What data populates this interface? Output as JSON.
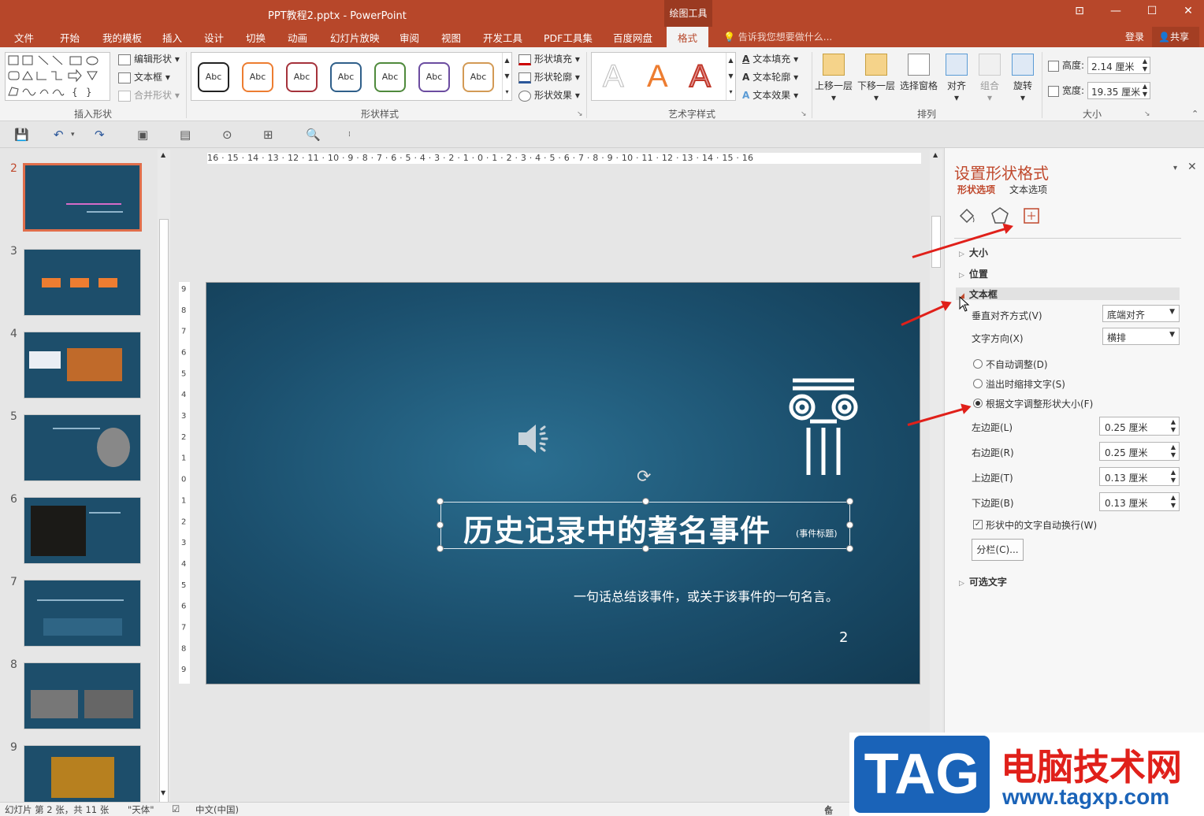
{
  "window": {
    "title": "PPT教程2.pptx - PowerPoint",
    "context_tab_group": "绘图工具",
    "controls": [
      "⊡",
      "—",
      "☐",
      "✕"
    ]
  },
  "menu": {
    "tabs": [
      "文件",
      "开始",
      "我的模板",
      "插入",
      "设计",
      "切换",
      "动画",
      "幻灯片放映",
      "审阅",
      "视图",
      "开发工具",
      "PDF工具集",
      "百度网盘",
      "格式"
    ],
    "active_tab": "格式",
    "tell_me": "告诉我您想要做什么...",
    "login": "登录",
    "share": "共享"
  },
  "ribbon": {
    "insert_shapes": {
      "label": "插入形状",
      "edit_shape": "编辑形状",
      "text_box": "文本框",
      "merge_shapes": "合并形状"
    },
    "shape_styles": {
      "label": "形状样式",
      "swatch_text": "Abc",
      "swatch_colors": [
        "#222222",
        "#ed7d31",
        "#a5323b",
        "#2f5f8a",
        "#4f8a3c",
        "#6b4ca0",
        "#d39a55"
      ],
      "fill": "形状填充",
      "outline": "形状轮廓",
      "effects": "形状效果"
    },
    "wordart_styles": {
      "label": "艺术字样式",
      "sample": "A",
      "text_fill": "文本填充",
      "text_outline": "文本轮廓",
      "text_effects": "文本效果"
    },
    "arrange": {
      "label": "排列",
      "bring_forward": "上移一层",
      "send_backward": "下移一层",
      "selection_pane": "选择窗格",
      "align": "对齐",
      "group": "组合",
      "rotate": "旋转"
    },
    "size": {
      "label": "大小",
      "height_label": "高度:",
      "height_value": "2.14 厘米",
      "width_label": "宽度:",
      "width_value": "19.35 厘米"
    }
  },
  "ruler": {
    "horizontal": "16 · 15 · 14 · 13 · 12 · 11 · 10 · 9 · 8 · 7 · 6 · 5 · 4 · 3 · 2 · 1 · 0 · 1 · 2 · 3 · 4 · 5 · 6 · 7 · 8 · 9 · 10 · 11 · 12 · 13 · 14 · 15 · 16",
    "vertical": [
      "9",
      "8",
      "7",
      "6",
      "5",
      "4",
      "3",
      "2",
      "1",
      "0",
      "1",
      "2",
      "3",
      "4",
      "5",
      "6",
      "7",
      "8",
      "9"
    ]
  },
  "thumbnails": [
    {
      "num": "2"
    },
    {
      "num": "3"
    },
    {
      "num": "4"
    },
    {
      "num": "5"
    },
    {
      "num": "6"
    },
    {
      "num": "7"
    },
    {
      "num": "8"
    },
    {
      "num": "9"
    }
  ],
  "slide": {
    "title": "历史记录中的著名事件",
    "title_tag": "(事件标题)",
    "tagline": "一句话总结该事件，或关于该事件的一句名言。",
    "page_number": "2"
  },
  "format_pane": {
    "title": "设置形状格式",
    "tabs": [
      "形状选项",
      "文本选项"
    ],
    "sections": {
      "size": "大小",
      "position": "位置",
      "textbox": "文本框",
      "alt_text": "可选文字"
    },
    "vertical_align_label": "垂直对齐方式(V)",
    "vertical_align_value": "底端对齐",
    "text_direction_label": "文字方向(X)",
    "text_direction_value": "横排",
    "autofit_options": [
      "不自动调整(D)",
      "溢出时缩排文字(S)",
      "根据文字调整形状大小(F)"
    ],
    "autofit_selected": 2,
    "margins": [
      {
        "label": "左边距(L)",
        "value": "0.25 厘米"
      },
      {
        "label": "右边距(R)",
        "value": "0.25 厘米"
      },
      {
        "label": "上边距(T)",
        "value": "0.13 厘米"
      },
      {
        "label": "下边距(B)",
        "value": "0.13 厘米"
      }
    ],
    "wrap_text": "形状中的文字自动换行(W)",
    "columns_button": "分栏(C)..."
  },
  "status": {
    "slide_info": "幻灯片 第 2 张，共 11 张",
    "theme": "\"天体\"",
    "language": "中文(中国)",
    "notes": "备注"
  },
  "watermark": {
    "tag": "TAG",
    "site_name": "电脑技术网",
    "url": "www.tagxp.com"
  }
}
